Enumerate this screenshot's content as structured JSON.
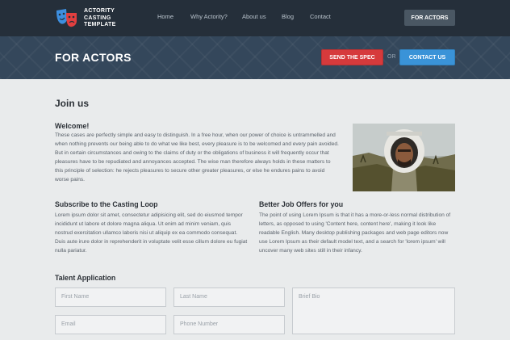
{
  "header": {
    "logo": {
      "line1": "ACTORITY",
      "line2": "CASTING",
      "line3": "TEMPLATE",
      "icon": "theater-masks-icon"
    },
    "nav": [
      "Home",
      "Why Actority?",
      "About us",
      "Blog",
      "Contact"
    ],
    "cta_label": "FOR ACTORS"
  },
  "banner": {
    "title": "FOR ACTORS",
    "spec_button": "SEND THE SPEC",
    "or_text": "OR",
    "contact_button": "CONTACT US"
  },
  "content": {
    "join_title": "Join us",
    "welcome_title": "Welcome!",
    "welcome_text": "These cases are perfectly simple and easy to distinguish. In a free hour, when our power of choice is untrammelled and when nothing prevents our being able to do what we like best, every pleasure is to be welcomed and every pain avoided. But in certain circumstances and owing to the claims of duty or the obligations of business it will frequently occur that pleasures have to be repudiated and annoyances accepted. The wise man therefore always holds in these matters to this principle of selection: he rejects pleasures to secure other greater pleasures, or else he endures pains to avoid worse pains.",
    "casting_title": "Subscribe to the Casting Loop",
    "casting_text": "Lorem ipsum dolor sit amet, consectetur adipisicing elit, sed do eiusmod tempor incididunt ut labore et dolore magna aliqua. Ut enim ad minim veniam, quis nostrud exercitation ullamco laboris nisi ut aliquip ex ea commodo consequat. Duis aute irure dolor in reprehenderit in voluptate velit esse cillum dolore eu fugiat nulla pariatur.",
    "better_title": "Better Job Offers for you",
    "better_text": " The point of using Lorem Ipsum is that it has a more-or-less normal distribution of letters, as opposed to using 'Content here, content here', making it look like readable English. Many desktop publishing packages and web page editors now use Lorem Ipsum as their default model text, and a search for 'lorem ipsum' will uncover many web sites still in their infancy."
  },
  "form": {
    "title": "Talent Application",
    "first_name": "First Name",
    "last_name": "Last Name",
    "bio": "Brief Bio",
    "email": "Email",
    "phone": "Phone Number"
  },
  "colors": {
    "topbar": "#252f3a",
    "banner": "#34475b",
    "spec_red": "#d63a3c",
    "contact_blue": "#3a93d8"
  }
}
